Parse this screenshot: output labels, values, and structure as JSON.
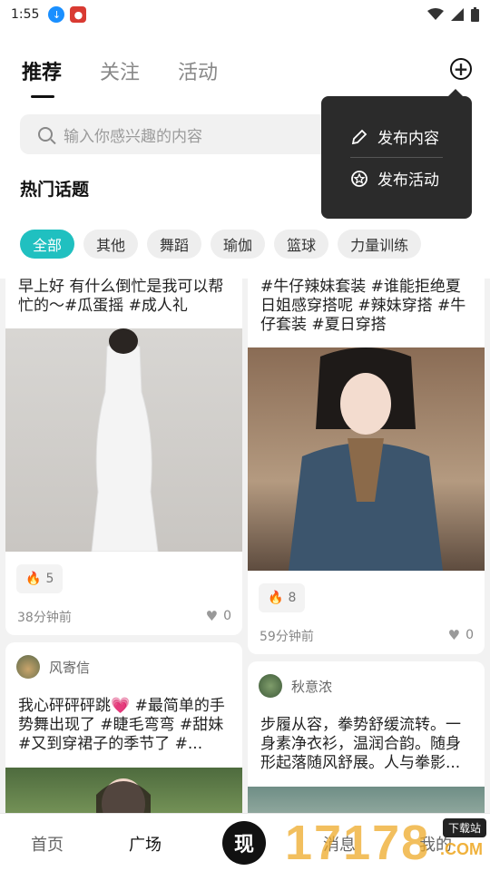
{
  "status": {
    "time": "1:55"
  },
  "tabs": [
    "推荐",
    "关注",
    "活动"
  ],
  "search": {
    "placeholder": "输入你感兴趣的内容"
  },
  "popover": {
    "items": [
      "发布内容",
      "发布活动"
    ]
  },
  "hot_topics": {
    "title": "热门话题",
    "chips": [
      "全部",
      "其他",
      "舞蹈",
      "瑜伽",
      "篮球",
      "力量训练"
    ]
  },
  "feed": {
    "left": [
      {
        "text": "早上好 有什么倒忙是我可以帮忙的～#瓜蛋摇 #成人礼",
        "heat": "5",
        "time": "38分钟前",
        "likes": "0"
      },
      {
        "author": "风寄信",
        "text": "我心砰砰砰跳💗 #最简单的手势舞出现了 #睫毛弯弯 #甜妹 #又到穿裙子的季节了 #..."
      }
    ],
    "right": [
      {
        "text": "#牛仔辣妹套装 #谁能拒绝夏日姐感穿搭呢 #辣妹穿搭 #牛仔套装 #夏日穿搭",
        "heat": "8",
        "time": "59分钟前",
        "likes": "0"
      },
      {
        "author": "秋意浓",
        "text": "步履从容，拳势舒缓流转。一身素净衣衫，温润合韵。随身形起落随风舒展。人与拳影..."
      }
    ]
  },
  "bottom_nav": {
    "items": [
      "首页",
      "广场",
      "消息",
      "我的"
    ],
    "logo_char": "现"
  },
  "watermark": {
    "number": "17178",
    "tag": "下载站",
    "suffix": ".COM"
  },
  "colors": {
    "accent": "#20c0c0",
    "popover_bg": "#2b2b2b",
    "flame": "#e53b2e"
  }
}
